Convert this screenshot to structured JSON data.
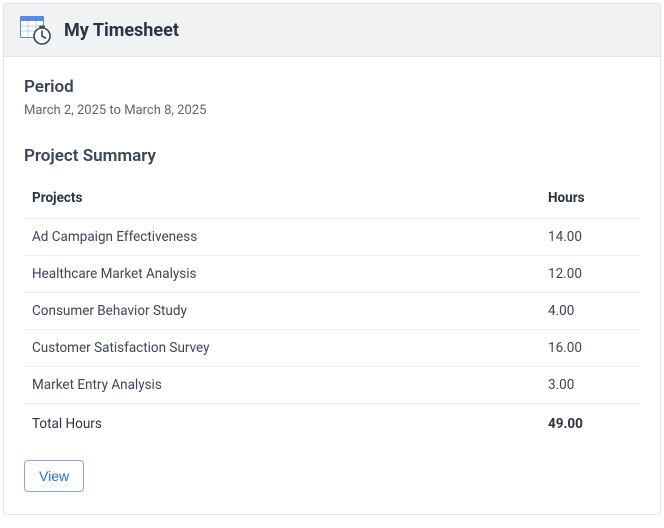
{
  "header": {
    "title": "My Timesheet"
  },
  "period": {
    "label": "Period",
    "text": "March 2, 2025 to March 8, 2025"
  },
  "summary": {
    "title": "Project Summary",
    "columns": {
      "projects": "Projects",
      "hours": "Hours"
    },
    "rows": [
      {
        "project": "Ad Campaign Effectiveness",
        "hours": "14.00"
      },
      {
        "project": "Healthcare Market Analysis",
        "hours": "12.00"
      },
      {
        "project": "Consumer Behavior Study",
        "hours": "4.00"
      },
      {
        "project": "Customer Satisfaction Survey",
        "hours": "16.00"
      },
      {
        "project": "Market Entry Analysis",
        "hours": "3.00"
      }
    ],
    "total": {
      "label": "Total Hours",
      "value": "49.00"
    }
  },
  "actions": {
    "view": "View"
  }
}
